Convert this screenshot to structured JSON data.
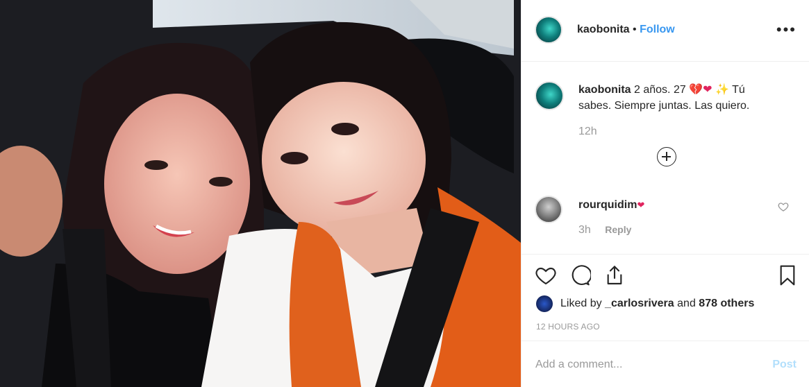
{
  "post": {
    "author": "kaobonita",
    "follow_label": "Follow",
    "more_icon": "more-options-icon",
    "caption_author": "kaobonita",
    "caption_text_1": "2 años. 27",
    "caption_text_2": "Tú",
    "caption_text_3": "sabes. Siempre juntas. Las quiero.",
    "caption_time": "12h",
    "comments": [
      {
        "author": "rourquidim",
        "time": "3h",
        "reply_label": "Reply"
      }
    ],
    "liked_by_prefix": "Liked by",
    "liked_by_user": "_carlosrivera",
    "liked_by_and": "and",
    "liked_by_others": "878 others",
    "timestamp": "12 HOURS AGO",
    "comment_placeholder": "Add a comment...",
    "post_label": "Post"
  },
  "colors": {
    "link": "#3897f0",
    "post_disabled": "#b2dffc",
    "muted": "#999999"
  }
}
